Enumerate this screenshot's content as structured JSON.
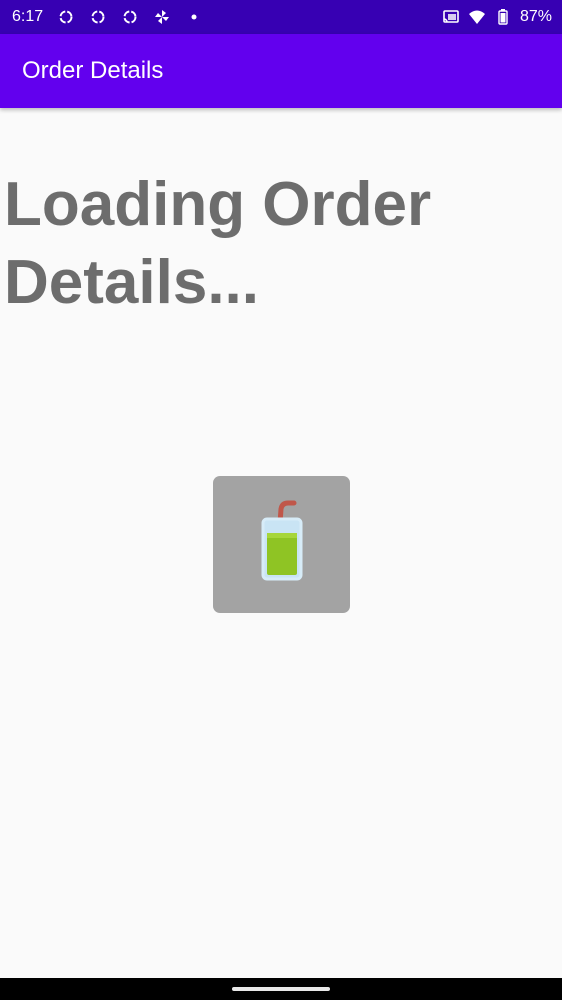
{
  "status_bar": {
    "time": "6:17",
    "battery_percent": "87%",
    "icons_left": [
      "sync-icon",
      "sync-icon",
      "sync-icon",
      "pinwheel-icon",
      "dot-icon"
    ],
    "icons_right": [
      "cast-icon",
      "wifi-icon",
      "battery-icon"
    ],
    "background": "#3700b3"
  },
  "app_bar": {
    "title": "Order Details",
    "background": "#6200ee"
  },
  "main": {
    "loading_text": "Loading Order Details...",
    "image_icon": "smoothie-cup-icon",
    "card_color": "#a3a3a3"
  }
}
